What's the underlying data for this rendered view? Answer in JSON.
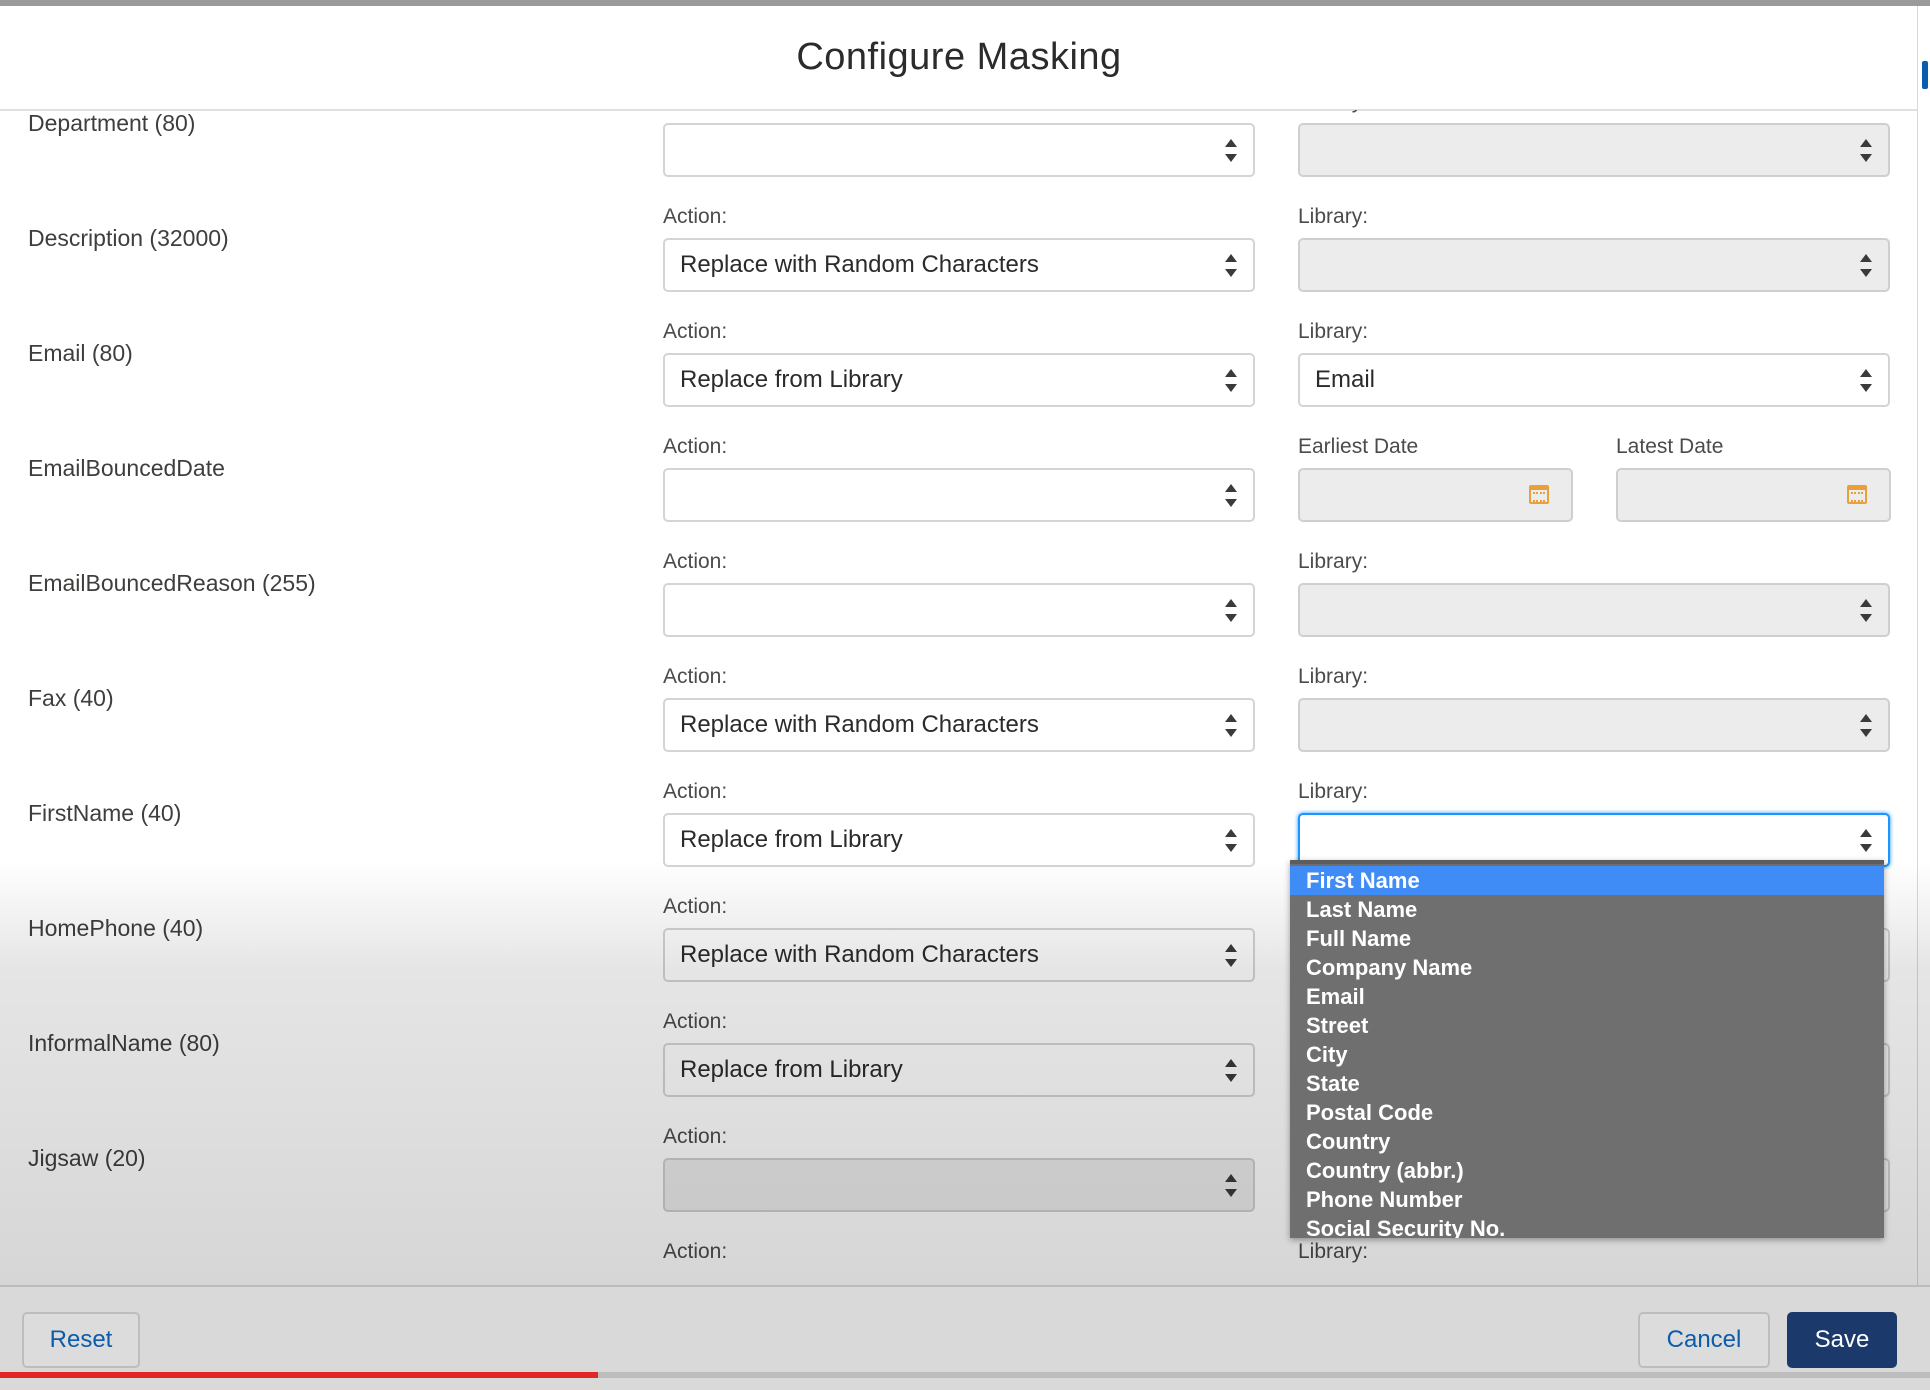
{
  "modal": {
    "title": "Configure Masking"
  },
  "labels": {
    "action": "Action:",
    "library": "Library:",
    "earliest_date": "Earliest Date",
    "latest_date": "Latest Date"
  },
  "fields": [
    {
      "name": "Department (80)",
      "action": "",
      "library": "",
      "library_disabled": true
    },
    {
      "name": "Description (32000)",
      "action": "Replace with Random Characters",
      "library": "",
      "library_disabled": true
    },
    {
      "name": "Email (80)",
      "action": "Replace from Library",
      "library": "Email",
      "library_disabled": false
    },
    {
      "name": "EmailBouncedDate",
      "action": "",
      "date_range": true
    },
    {
      "name": "EmailBouncedReason (255)",
      "action": "",
      "library": "",
      "library_disabled": true
    },
    {
      "name": "Fax (40)",
      "action": "Replace with Random Characters",
      "library": "",
      "library_disabled": true
    },
    {
      "name": "FirstName (40)",
      "action": "Replace from Library",
      "library": "",
      "library_focused": true
    },
    {
      "name": "HomePhone (40)",
      "action": "Replace with Random Characters"
    },
    {
      "name": "InformalName (80)",
      "action": "Replace from Library"
    },
    {
      "name": "Jigsaw (20)",
      "action": "",
      "action_disabled": true
    },
    {
      "name": "",
      "action": ""
    }
  ],
  "library_dropdown": {
    "selected": "First Name",
    "options": [
      "First Name",
      "Last Name",
      "Full Name",
      "Company Name",
      "Email",
      "Street",
      "City",
      "State",
      "Postal Code",
      "Country",
      "Country (abbr.)",
      "Phone Number",
      "Social Security No."
    ]
  },
  "footer": {
    "reset": "Reset",
    "cancel": "Cancel",
    "save": "Save"
  },
  "video_progress": 0.31
}
